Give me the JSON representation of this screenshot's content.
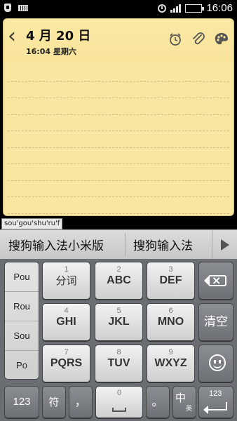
{
  "status_bar": {
    "time": "16:06",
    "battery_level": 1.0,
    "signal_bars": 4,
    "icons": [
      "notification-icon",
      "keyboard-icon",
      "alarm-icon",
      "signal-icon",
      "battery-icon"
    ]
  },
  "note": {
    "date": "4 月 20 日",
    "time_weekday": "16:04 星期六",
    "tools": [
      "alarm-clock-icon",
      "paperclip-icon",
      "palette-icon"
    ],
    "body_text": ""
  },
  "ime": {
    "pinyin_tooltip": "sou'gou'shu'ru'f",
    "candidates": [
      "搜狗输入法小米版",
      "搜狗输入法"
    ],
    "pinyin_options": [
      "Pou",
      "Rou",
      "Sou",
      "Po"
    ],
    "keys": [
      {
        "num": "1",
        "label": "分词"
      },
      {
        "num": "2",
        "label": "ABC"
      },
      {
        "num": "3",
        "label": "DEF"
      },
      {
        "num": "4",
        "label": "GHI"
      },
      {
        "num": "5",
        "label": "JKL"
      },
      {
        "num": "6",
        "label": "MNO"
      },
      {
        "num": "7",
        "label": "PQRS"
      },
      {
        "num": "8",
        "label": "TUV"
      },
      {
        "num": "9",
        "label": "WXYZ"
      }
    ],
    "clear_label": "清空",
    "bottom": {
      "num_label": "123",
      "symbol_label": "符",
      "comma_label": "，",
      "space_num": "0",
      "period_label": "。",
      "lang_main": "中",
      "lang_alt": "英",
      "enter_label": "123"
    }
  },
  "colors": {
    "note_paper": "#f9e6a0",
    "keyboard_bg": "#6a6d72",
    "battery": "#4ad14a"
  }
}
